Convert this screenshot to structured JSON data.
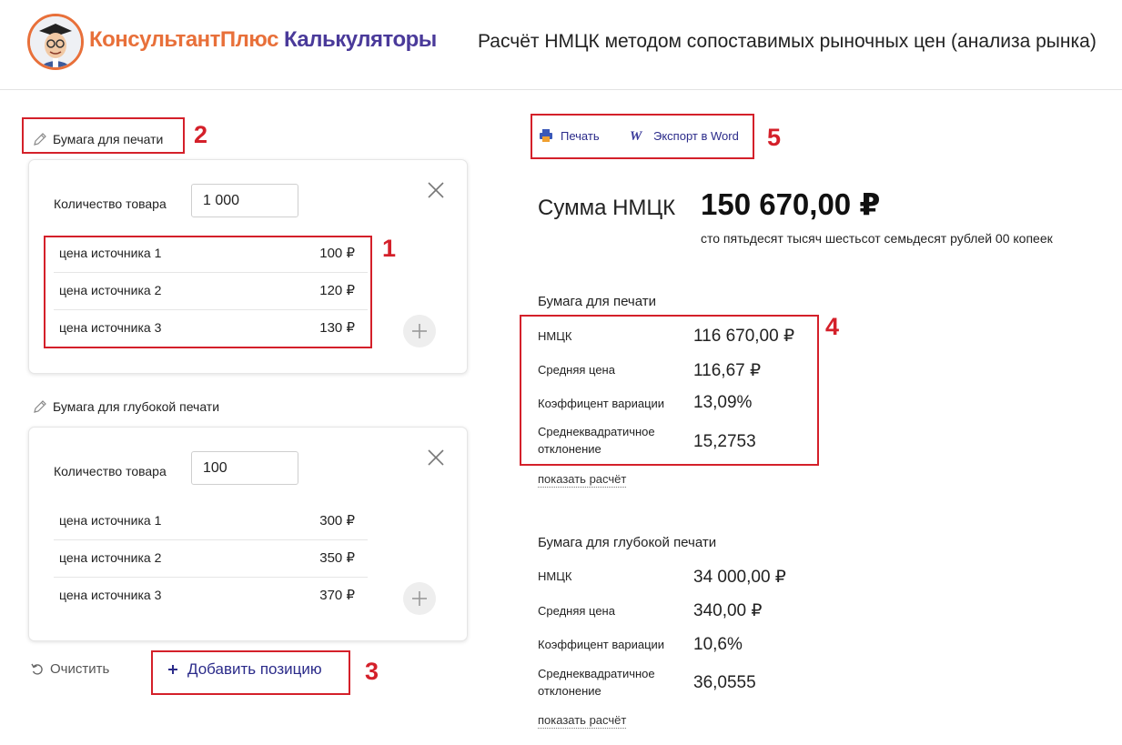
{
  "header": {
    "brand_part1": "КонсультантПлюс",
    "brand_part2": "Калькуляторы",
    "title": "Расчёт НМЦК методом сопоставимых рыночных цен (анализа рынка)"
  },
  "positions": [
    {
      "name": "Бумага для печати",
      "qty_label": "Количество товара",
      "qty_value": "1 000",
      "prices": [
        {
          "label": "цена источника 1",
          "value": "100 ₽"
        },
        {
          "label": "цена источника 2",
          "value": "120 ₽"
        },
        {
          "label": "цена источника 3",
          "value": "130 ₽"
        }
      ]
    },
    {
      "name": "Бумага для глубокой печати",
      "qty_label": "Количество товара",
      "qty_value": "100",
      "prices": [
        {
          "label": "цена источника 1",
          "value": "300 ₽"
        },
        {
          "label": "цена источника 2",
          "value": "350 ₽"
        },
        {
          "label": "цена источника 3",
          "value": "370 ₽"
        }
      ]
    }
  ],
  "actions": {
    "clear_label": "Очистить",
    "add_label": "Добавить позицию",
    "print_label": "Печать",
    "export_label": "Экспорт в Word"
  },
  "summary": {
    "label": "Сумма НМЦК",
    "value": "150 670,00 ₽",
    "words": "сто пятьдесят тысяч шестьсот семьдесят рублей 00 копеек"
  },
  "results": [
    {
      "title": "Бумага для печати",
      "stats": [
        {
          "label": "НМЦК",
          "value": "116 670,00 ₽"
        },
        {
          "label": "Средняя цена",
          "value": "116,67 ₽"
        },
        {
          "label": "Коэффицент вариации",
          "value": "13,09%"
        },
        {
          "label": "Среднеквадратичное отклонение",
          "value": "15,2753"
        }
      ],
      "show_calc": "показать расчёт"
    },
    {
      "title": "Бумага для глубокой печати",
      "stats": [
        {
          "label": "НМЦК",
          "value": "34 000,00 ₽"
        },
        {
          "label": "Средняя цена",
          "value": "340,00 ₽"
        },
        {
          "label": "Коэффицент вариации",
          "value": "10,6%"
        },
        {
          "label": "Среднеквадратичное отклонение",
          "value": "36,0555"
        }
      ],
      "show_calc": "показать расчёт"
    }
  ],
  "annotations": {
    "n1": "1",
    "n2": "2",
    "n3": "3",
    "n4": "4",
    "n5": "5",
    "color": "#d4202a"
  },
  "colors": {
    "brand_orange": "#e8703a",
    "brand_purple": "#4a3a9a",
    "link_blue": "#2b2b8a"
  }
}
